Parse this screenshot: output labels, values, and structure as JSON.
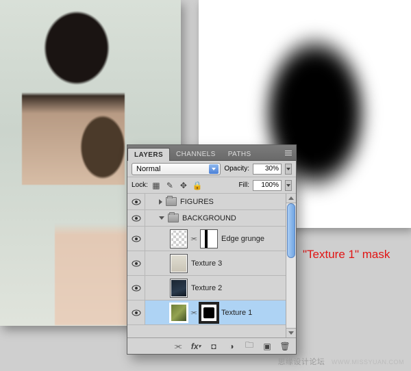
{
  "panel": {
    "tabs": {
      "layers": "LAYERS",
      "channels": "CHANNELS",
      "paths": "PATHS"
    },
    "blend_mode": "Normal",
    "opacity_label": "Opacity:",
    "opacity_value": "30%",
    "lock_label": "Lock:",
    "fill_label": "Fill:",
    "fill_value": "100%",
    "groups": {
      "figures": "FIGURES",
      "background": "BACKGROUND"
    },
    "layers": {
      "edge_grunge": "Edge grunge",
      "texture3": "Texture 3",
      "texture2": "Texture 2",
      "texture1": "Texture 1"
    }
  },
  "annotation": "\"Texture 1\" mask",
  "watermark": {
    "main": "思缘设计论坛",
    "sub": "WWW.MISSYUAN.COM"
  }
}
